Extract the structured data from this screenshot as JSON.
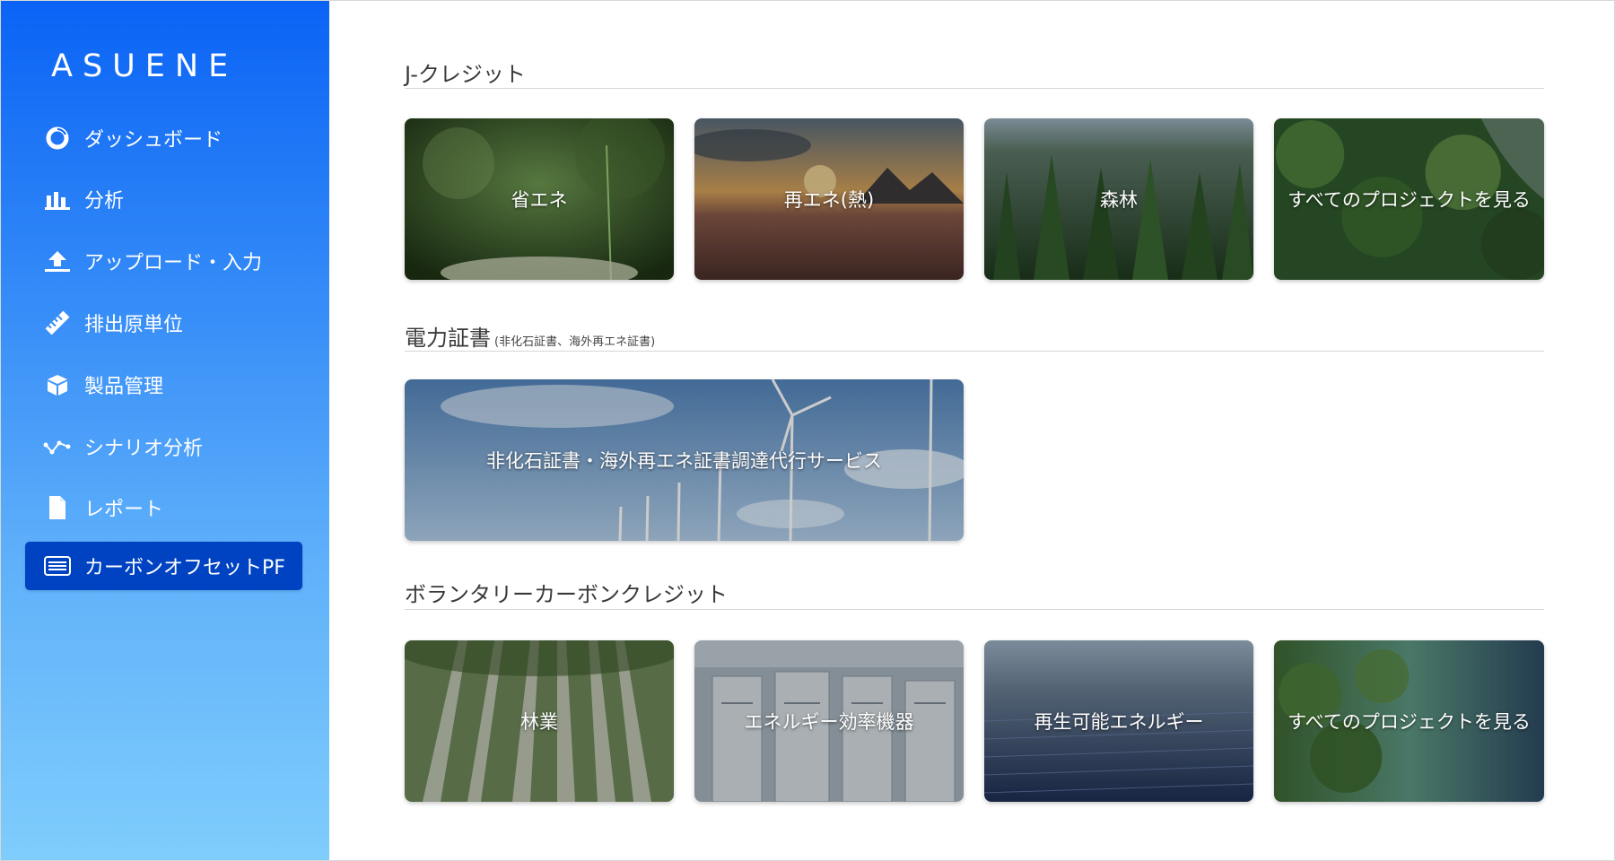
{
  "app": {
    "logo": "ASUENE"
  },
  "sidebar": {
    "items": [
      {
        "label": "ダッシュボード",
        "icon": "dashboard-icon"
      },
      {
        "label": "分析",
        "icon": "bar-chart-icon"
      },
      {
        "label": "アップロード・入力",
        "icon": "upload-icon"
      },
      {
        "label": "排出原単位",
        "icon": "ruler-icon"
      },
      {
        "label": "製品管理",
        "icon": "box-icon"
      },
      {
        "label": "シナリオ分析",
        "icon": "scenario-icon"
      },
      {
        "label": "レポート",
        "icon": "document-icon"
      },
      {
        "label": "カーボンオフセットPF",
        "icon": "keyboard-icon",
        "active": true
      }
    ]
  },
  "sections": {
    "jcredit": {
      "title": "J-クレジット",
      "cards": [
        "省エネ",
        "再エネ(熱)",
        "森林",
        "すべてのプロジェクトを見る"
      ]
    },
    "power": {
      "title": "電力証書",
      "subtitle": "(非化石証書、海外再エネ証書)",
      "cards": [
        "非化石証書・海外再エネ証書調達代行サービス"
      ]
    },
    "voluntary": {
      "title": "ボランタリーカーボンクレジット",
      "cards": [
        "林業",
        "エネルギー効率機器",
        "再生可能エネルギー",
        "すべてのプロジェクトを見る"
      ]
    }
  },
  "colors": {
    "sidebar_top": "#0a63f5",
    "sidebar_bottom": "#7fcdfc",
    "active_item": "#0043c2"
  }
}
